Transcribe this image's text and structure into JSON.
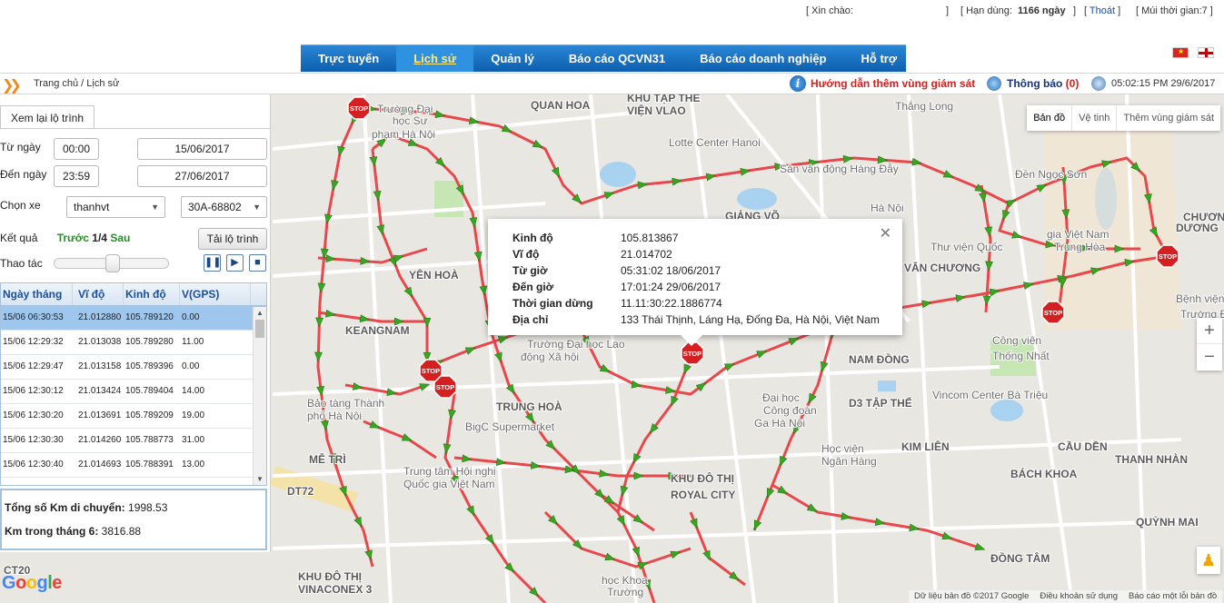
{
  "topbar": {
    "greeting": "[ Xin chào:",
    "greeting_end": "]",
    "expiry_label": "[ Hạn dùng:",
    "expiry_value": "1166 ngày",
    "expiry_end": "]",
    "logout": "Thoát",
    "timezone": "[ Múi thời gian:7 ]"
  },
  "nav": {
    "items": [
      "Trực tuyến",
      "Lịch sử",
      "Quản lý",
      "Báo cáo QCVN31",
      "Báo cáo doanh nghiệp",
      "Hỗ trợ"
    ],
    "active": "Lịch sử"
  },
  "breadcrumb": "Trang chủ / Lịch sử",
  "header_right": {
    "guide": "Hướng dẫn thêm vùng giám sát",
    "notification_label": "Thông báo",
    "notification_count": "(0)",
    "datetime": "05:02:15 PM 29/6/2017"
  },
  "panel": {
    "tab": "Xem lại lộ trình",
    "from_date_label": "Từ ngày",
    "from_time": "00:00",
    "from_date": "15/06/2017",
    "to_date_label": "Đến ngày",
    "to_time": "23:59",
    "to_date": "27/06/2017",
    "vehicle_label": "Chọn xe",
    "vehicle_user": "thanhvt",
    "vehicle_plate": "30A-68802",
    "result_label": "Kết quả",
    "result_prev": "Trước",
    "result_page": "1/4",
    "result_next": "Sau",
    "load_button": "Tải lộ trình",
    "action_label": "Thao tác",
    "playback_position": 0.5,
    "columns": [
      "Ngày tháng",
      "Vĩ độ",
      "Kinh độ",
      "V(GPS)"
    ],
    "rows": [
      [
        "15/06 06:30:53",
        "21.012880",
        "105.789120",
        "0.00"
      ],
      [
        "15/06 12:29:32",
        "21.013038",
        "105.789280",
        "11.00"
      ],
      [
        "15/06 12:29:47",
        "21.013158",
        "105.789396",
        "0.00"
      ],
      [
        "15/06 12:30:12",
        "21.013424",
        "105.789404",
        "14.00"
      ],
      [
        "15/06 12:30:20",
        "21.013691",
        "105.789209",
        "19.00"
      ],
      [
        "15/06 12:30:30",
        "21.014260",
        "105.788773",
        "31.00"
      ],
      [
        "15/06 12:30:40",
        "21.014693",
        "105.788391",
        "13.00"
      ]
    ],
    "selected_row": 0,
    "total_km_label": "Tổng số Km di chuyển:",
    "total_km_value": "1998.53",
    "month_km_label": "Km trong tháng 6:",
    "month_km_value": "3816.88"
  },
  "infowindow": {
    "fields": [
      {
        "key": "Kinh độ",
        "value": "105.813867"
      },
      {
        "key": "Vĩ độ",
        "value": "21.014702"
      },
      {
        "key": "Từ giờ",
        "value": "05:31:02 18/06/2017"
      },
      {
        "key": "Đến giờ",
        "value": "17:01:24 29/06/2017"
      },
      {
        "key": "Thời gian dừng",
        "value": "11.11:30:22.1886774"
      },
      {
        "key": "Địa chỉ",
        "value": "133 Thái Thịnh, Láng Hạ, Đống Đa, Hà Nội, Việt Nam"
      }
    ]
  },
  "map": {
    "type_buttons": [
      "Bản đồ",
      "Vệ tinh",
      "Thêm vùng giám sát"
    ],
    "stop_label": "STOP",
    "zoom_in": "+",
    "zoom_out": "−",
    "footer": [
      "Dữ liệu bản đồ ©2017 Google",
      "Điều khoản sử dụng",
      "Báo cáo một lỗi bản đồ"
    ],
    "google": "Google",
    "places": [
      "KHU TẬP THỂ",
      "VIỆN VLAO",
      "QUAN HOA",
      "Lotte Center Hanoi",
      "Sân vận động Hàng Đẫy",
      "Hà Nội",
      "Đền Ngọc Sơn",
      "YÊN HOÀ",
      "KEANGNAM",
      "TRUNG HOÀ",
      "Bảo tàng Thành",
      "phố Hà Nội",
      "BigC Supermarket",
      "Trường Đại học Lao",
      "động Xã hội",
      "NAM ĐỒNG",
      "D3 TẬP THỂ",
      "Vincom Center Bà Triệu",
      "KIM LIÊN",
      "BÁCH KHOA",
      "KHU ĐÔ THỊ",
      "ROYAL CITY",
      "Trung tâm Hội nghị",
      "Quốc gia Việt Nam",
      "MỄ TRÌ",
      "KHU ĐÔ THỊ",
      "VINACONEX 3",
      "Công viên",
      "Thống Nhất",
      "Học viện",
      "Ngân Hàng",
      "ĐỒNG TÂM",
      "QUỲNH MAI",
      "THANH NHÀN",
      "CẦU DỀN",
      "VĂN CHƯƠNG",
      "Thắng Long",
      "Trường Đại",
      "học Sư",
      "phạm Hà Nội",
      "GIẢNG VÕ",
      "CHƯƠNG",
      "DƯƠNG",
      "Bệnh viện",
      "Trường Đại",
      "học Khoa",
      "Trường",
      "Đại học",
      "Công đoàn",
      "Ga Hà Nội",
      "Thư viện Quốc",
      "gia Việt Nam",
      "Trung Hòa",
      "DT72",
      "CT20"
    ]
  },
  "colors": {
    "nav": "#0c5fae",
    "route": "#e8474b",
    "arrow": "#3aa51f",
    "stop": "#d42020"
  }
}
